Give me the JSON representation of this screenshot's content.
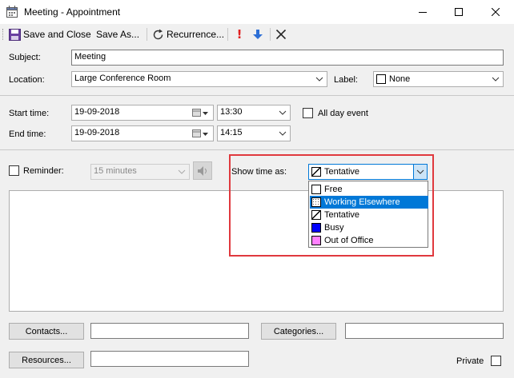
{
  "window": {
    "title": "Meeting - Appointment",
    "minimize_icon": "minimize-icon",
    "maximize_icon": "maximize-icon",
    "close_icon": "close-icon"
  },
  "toolbar": {
    "save_close_label": "Save and Close",
    "save_as_label": "Save As...",
    "recurrence_label": "Recurrence..."
  },
  "form": {
    "subject_label": "Subject:",
    "subject_value": "Meeting",
    "location_label": "Location:",
    "location_value": "Large Conference Room",
    "label_label": "Label:",
    "label_value": "None",
    "start_label": "Start time:",
    "start_date": "19-09-2018",
    "start_time": "13:30",
    "allday_label": "All day event",
    "end_label": "End time:",
    "end_date": "19-09-2018",
    "end_time": "14:15",
    "reminder_label": "Reminder:",
    "reminder_value": "15 minutes",
    "show_time_label": "Show time as:",
    "show_time_value": "Tentative",
    "contacts_label": "Contacts...",
    "categories_label": "Categories...",
    "resources_label": "Resources...",
    "private_label": "Private"
  },
  "show_time_options": [
    {
      "label": "Free",
      "color": "#ffffff"
    },
    {
      "label": "Working Elsewhere",
      "color": "#ffffff",
      "selected": true
    },
    {
      "label": "Tentative",
      "color": "#ffffff"
    },
    {
      "label": "Busy",
      "color": "#0000ff"
    },
    {
      "label": "Out of Office",
      "color": "#ff80ff"
    }
  ],
  "colors": {
    "highlight": "#0078d7",
    "annotation_box": "#e0393e"
  }
}
